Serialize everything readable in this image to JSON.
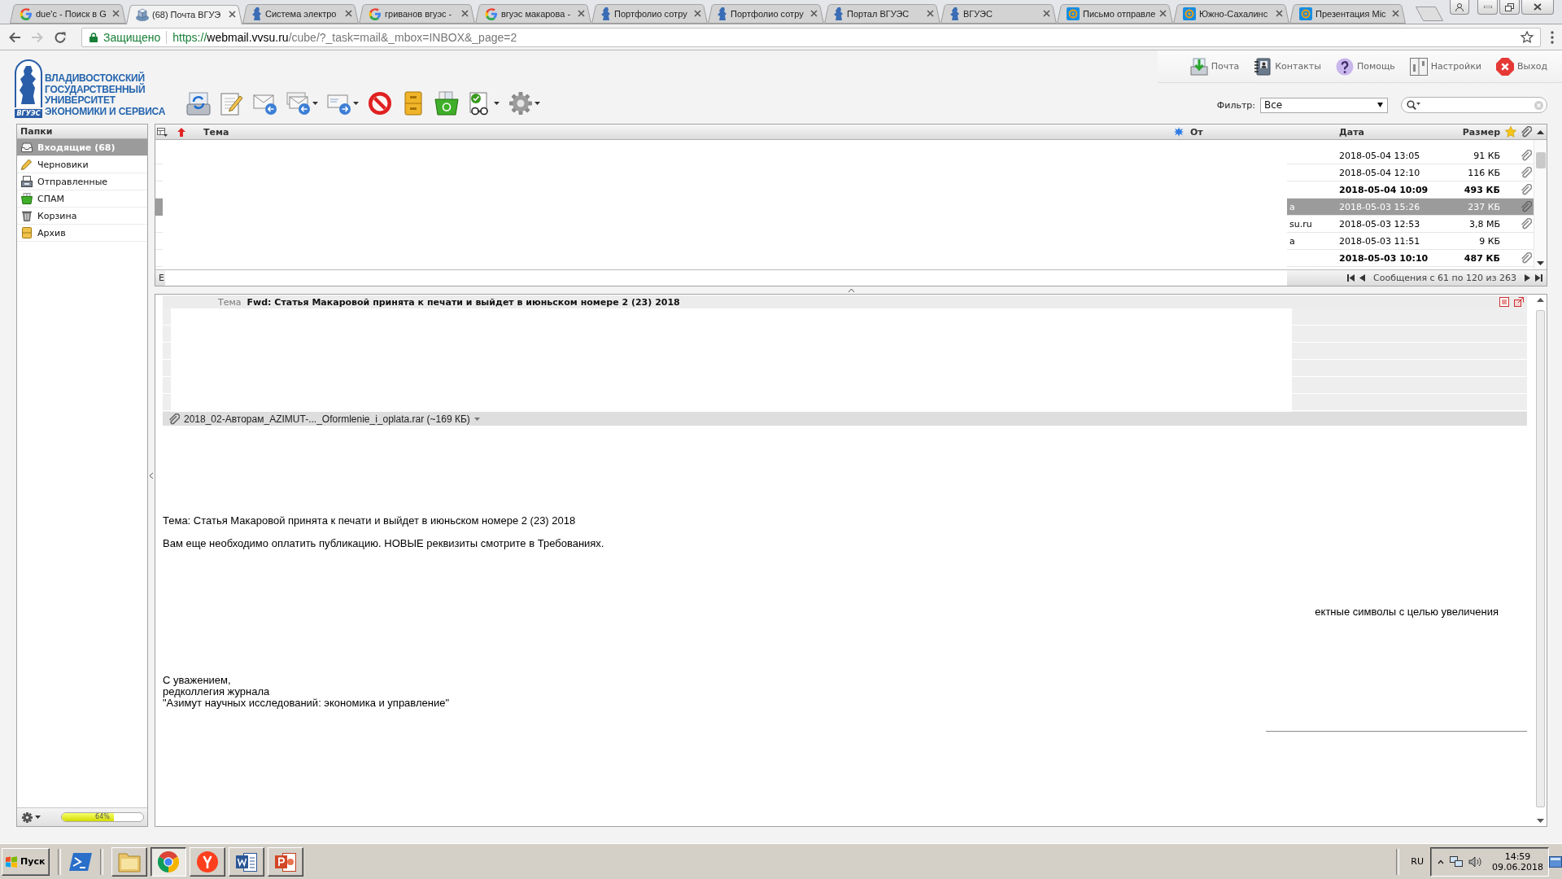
{
  "browser": {
    "tabs": [
      {
        "title": "due'c - Поиск в G",
        "kind": "google",
        "selected": false
      },
      {
        "title": "(68) Почта ВГУЭ",
        "kind": "webmail",
        "selected": true
      },
      {
        "title": "Система электро",
        "kind": "vvsu",
        "selected": false
      },
      {
        "title": "гриванов вгуэс -",
        "kind": "google",
        "selected": false
      },
      {
        "title": "вгуэс макарова -",
        "kind": "google",
        "selected": false
      },
      {
        "title": "Портфолио сотру",
        "kind": "vvsu",
        "selected": false
      },
      {
        "title": "Портфолио сотру",
        "kind": "vvsu",
        "selected": false
      },
      {
        "title": "Портал ВГУЭС",
        "kind": "vvsu",
        "selected": false
      },
      {
        "title": "ВГУЭС",
        "kind": "vvsu",
        "selected": false
      },
      {
        "title": "Письмо отправле",
        "kind": "mailru",
        "selected": false
      },
      {
        "title": "Южно-Сахалинс",
        "kind": "mailru",
        "selected": false
      },
      {
        "title": "Презентация Mic",
        "kind": "mailru",
        "selected": false
      }
    ],
    "address_bar": {
      "security": "Защищено",
      "url_scheme": "https://",
      "url_host": "webmail.vvsu.ru",
      "url_path": "/cube/?_task=mail&_mbox=INBOX&_page=2"
    }
  },
  "header": {
    "logo": {
      "lines": [
        "ВЛАДИВОСТОКСКИЙ",
        "ГОСУДАРСТВЕННЫЙ",
        "УНИВЕРСИТЕТ",
        "ЭКОНОМИКИ И СЕРВИСА"
      ],
      "badge": "ВГУЭС"
    },
    "nav": [
      {
        "label": "Почта",
        "kind": "mail"
      },
      {
        "label": "Контакты",
        "kind": "contacts"
      },
      {
        "label": "Помощь",
        "kind": "help"
      },
      {
        "label": "Настройки",
        "kind": "settings"
      },
      {
        "label": "Выход",
        "kind": "logout"
      }
    ],
    "toolbar": [
      {
        "kind": "check-mail",
        "dropdown": false
      },
      {
        "kind": "compose",
        "dropdown": false
      },
      {
        "kind": "reply",
        "dropdown": false
      },
      {
        "kind": "reply-all",
        "dropdown": true
      },
      {
        "kind": "forward",
        "dropdown": true
      },
      {
        "kind": "delete",
        "dropdown": false
      },
      {
        "kind": "archive",
        "dropdown": false
      },
      {
        "kind": "spam",
        "dropdown": false
      },
      {
        "kind": "mark",
        "dropdown": true
      },
      {
        "kind": "more",
        "dropdown": true
      }
    ],
    "filter": {
      "label": "Фильтр:",
      "value": "Все"
    }
  },
  "folders": {
    "title": "Папки",
    "items": [
      {
        "name": "Входящие (68)",
        "kind": "inbox",
        "selected": true
      },
      {
        "name": "Черновики",
        "kind": "drafts",
        "selected": false
      },
      {
        "name": "Отправленные",
        "kind": "sent",
        "selected": false
      },
      {
        "name": "СПАМ",
        "kind": "spam",
        "selected": false
      },
      {
        "name": "Корзина",
        "kind": "trash",
        "selected": false
      },
      {
        "name": "Архив",
        "kind": "archive",
        "selected": false
      }
    ]
  },
  "quota": {
    "level": 0.64,
    "reading": "64%"
  },
  "message_list": {
    "columns": {
      "subject": "Тема",
      "from": "От",
      "date": "Дата",
      "size": "Размер"
    },
    "rows": [
      {
        "date": "2018-05-04 13:05",
        "size": "91 КБ",
        "attachment": true,
        "unread": false,
        "selected": false
      },
      {
        "date": "2018-05-04 12:10",
        "size": "116 КБ",
        "attachment": true,
        "unread": false,
        "selected": false
      },
      {
        "date": "2018-05-04 10:09",
        "size": "493 КБ",
        "attachment": true,
        "unread": true,
        "selected": false
      },
      {
        "from": "а",
        "date": "2018-05-03 15:26",
        "size": "237 КБ",
        "attachment": true,
        "unread": false,
        "selected": true
      },
      {
        "from": "su.ru",
        "date": "2018-05-03 12:53",
        "size": "3,8 МБ",
        "attachment": true,
        "unread": false,
        "selected": false
      },
      {
        "from": "а",
        "date": "2018-05-03 11:51",
        "size": "9 КБ",
        "attachment": false,
        "unread": false,
        "selected": false
      },
      {
        "date": "2018-05-03 10:10",
        "size": "487 КБ",
        "attachment": true,
        "unread": true,
        "selected": false
      }
    ],
    "footer": {
      "cut_text": "Е",
      "range": "Сообщения с 61 по 120 из 263"
    }
  },
  "preview": {
    "subject_label": "Тема",
    "subject": "Fwd: Статья Макаровой принята к печати и выйдет в июньском номере 2 (23) 2018",
    "attachment": "2018_02-Авторам_AZIMUT-..._Oformlenie_i_oplata.rar (~169 КБ)",
    "paragraphs": [
      "Тема: Статья Макаровой принята к печати и выйдет в июньском номере 2 (23) 2018",
      "Вам еще необходимо оплатить публикацию. НОВЫЕ реквизиты смотрите в Требованиях."
    ],
    "fragment": "ектные символы с целью увеличения",
    "signature": [
      "С уважением,",
      "редколлегия журнала",
      "\"Азимут научных исследований: экономика и управление\""
    ]
  },
  "taskbar": {
    "start": "Пуск",
    "apps": [
      {
        "kind": "explorer",
        "selected": false
      },
      {
        "kind": "chrome",
        "selected": true
      },
      {
        "kind": "yandex",
        "selected": false
      },
      {
        "kind": "word",
        "selected": false
      },
      {
        "kind": "powerpoint",
        "selected": false
      }
    ],
    "language": "RU",
    "time": "14:59",
    "date": "09.06.2018"
  }
}
